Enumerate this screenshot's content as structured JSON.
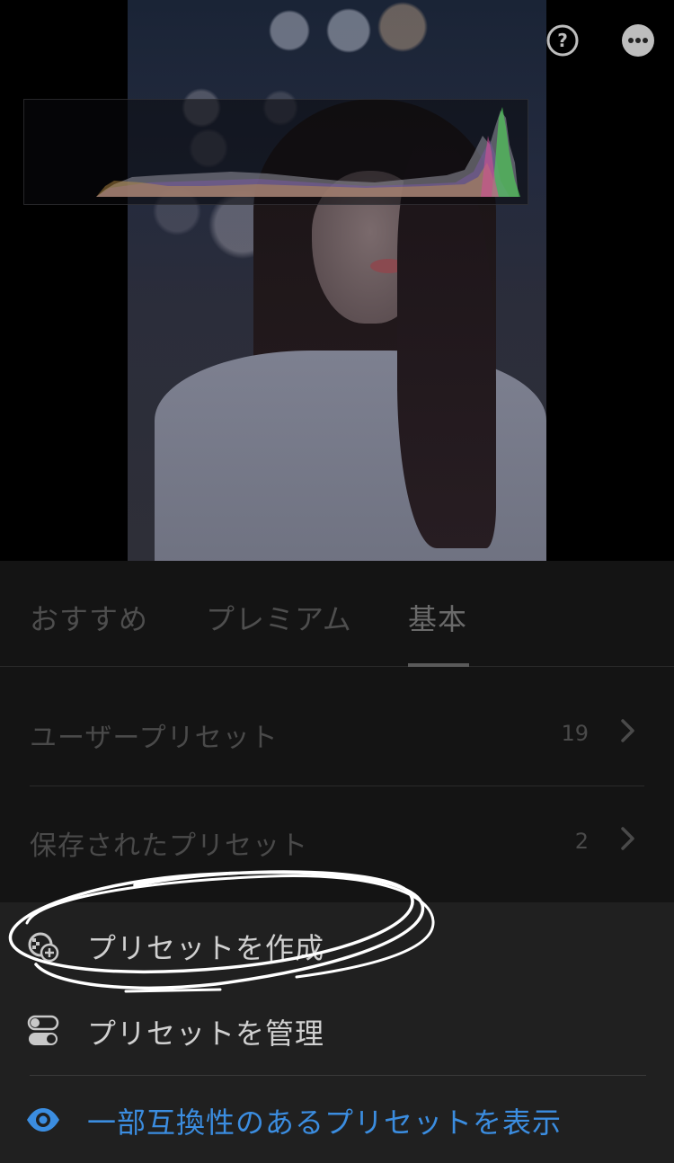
{
  "toolbar": {
    "help_icon": "question-circle-icon",
    "more_icon": "more-horizontal-icon"
  },
  "tabs": [
    {
      "label": "おすすめ"
    },
    {
      "label": "プレミアム"
    },
    {
      "label": "基本"
    }
  ],
  "selected_tab": "基本",
  "list": [
    {
      "label": "ユーザープリセット",
      "count": "19"
    },
    {
      "label": "保存されたプリセット",
      "count": "2"
    }
  ],
  "menu": {
    "create_label": "プリセットを作成",
    "manage_label": "プリセットを管理",
    "show_label": "一部互換性のあるプリセットを表示"
  },
  "colors": {
    "accent": "#3b8de0",
    "panel_bg": "#141414",
    "sheet_bg": "#202020",
    "annotation": "#ffffff"
  }
}
